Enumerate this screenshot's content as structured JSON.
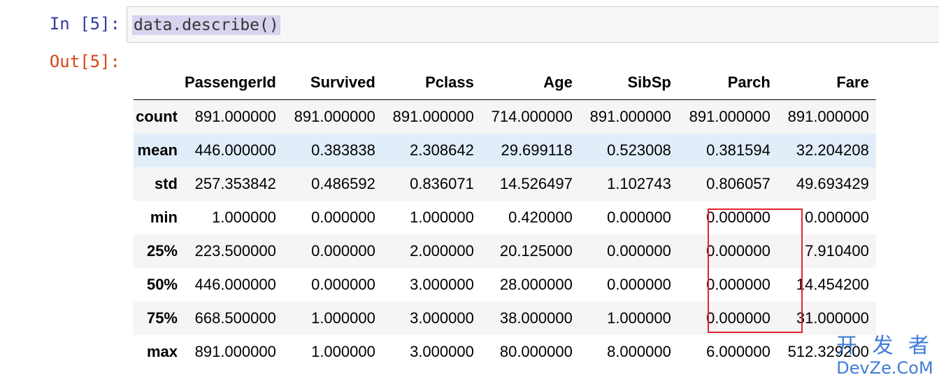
{
  "cell": {
    "in_prompt": "In  [5]:",
    "out_prompt": "Out[5]:",
    "code": "data.describe()"
  },
  "table": {
    "columns": [
      "PassengerId",
      "Survived",
      "Pclass",
      "Age",
      "SibSp",
      "Parch",
      "Fare"
    ],
    "rows": [
      {
        "label": "count",
        "values": [
          "891.000000",
          "891.000000",
          "891.000000",
          "714.000000",
          "891.000000",
          "891.000000",
          "891.000000"
        ]
      },
      {
        "label": "mean",
        "values": [
          "446.000000",
          "0.383838",
          "2.308642",
          "29.699118",
          "0.523008",
          "0.381594",
          "32.204208"
        ]
      },
      {
        "label": "std",
        "values": [
          "257.353842",
          "0.486592",
          "0.836071",
          "14.526497",
          "1.102743",
          "0.806057",
          "49.693429"
        ]
      },
      {
        "label": "min",
        "values": [
          "1.000000",
          "0.000000",
          "1.000000",
          "0.420000",
          "0.000000",
          "0.000000",
          "0.000000"
        ]
      },
      {
        "label": "25%",
        "values": [
          "223.500000",
          "0.000000",
          "2.000000",
          "20.125000",
          "0.000000",
          "0.000000",
          "7.910400"
        ]
      },
      {
        "label": "50%",
        "values": [
          "446.000000",
          "0.000000",
          "3.000000",
          "28.000000",
          "0.000000",
          "0.000000",
          "14.454200"
        ]
      },
      {
        "label": "75%",
        "values": [
          "668.500000",
          "1.000000",
          "3.000000",
          "38.000000",
          "1.000000",
          "0.000000",
          "31.000000"
        ]
      },
      {
        "label": "max",
        "values": [
          "891.000000",
          "1.000000",
          "3.000000",
          "80.000000",
          "8.000000",
          "6.000000",
          "512.329200"
        ]
      }
    ]
  },
  "annotation": {
    "box_color": "#e0242c"
  },
  "watermark": {
    "top": "开 发 者",
    "bottom": "DevZe.CoM"
  }
}
